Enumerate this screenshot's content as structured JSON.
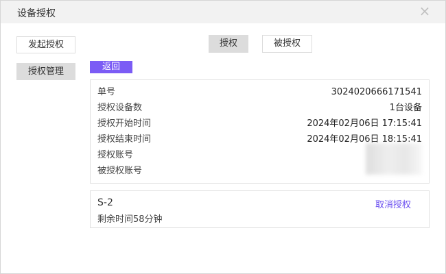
{
  "window": {
    "title": "设备授权",
    "close_glyph": "×"
  },
  "sidebar": {
    "initiate_label": "发起授权",
    "manage_label": "授权管理"
  },
  "tabs": [
    {
      "label": "授权"
    },
    {
      "label": "被授权"
    }
  ],
  "back_label": "返回",
  "details": [
    {
      "label": "单号",
      "value": "3024020666171541"
    },
    {
      "label": "授权设备数",
      "value": "1台设备"
    },
    {
      "label": "授权开始时间",
      "value": "2024年02月06日 17:15:41"
    },
    {
      "label": "授权结束时间",
      "value": "2024年02月06日 18:15:41"
    },
    {
      "label": "授权账号",
      "value": ""
    },
    {
      "label": "被授权账号",
      "value": ""
    }
  ],
  "device": {
    "name": "S-2",
    "remaining": "剩余时间58分钟",
    "cancel_label": "取消授权"
  },
  "colors": {
    "accent": "#7b5cf5",
    "link": "#6b4ff0",
    "titlebar": "#f2f2f2"
  }
}
